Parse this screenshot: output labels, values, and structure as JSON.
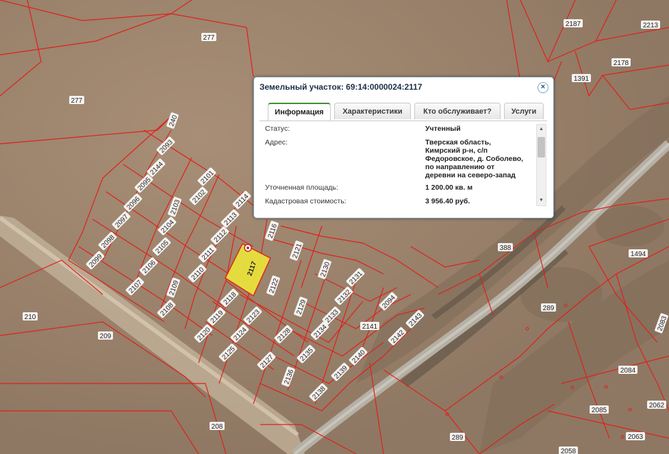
{
  "popup": {
    "title": "Земельный участок: 69:14:0000024:2117",
    "close_label": "×",
    "tabs": [
      "Информация",
      "Характеристики",
      "Кто обслуживает?",
      "Услуги"
    ],
    "active_tab": "Информация",
    "rows": [
      {
        "label": "Статус:",
        "value": "Учтенный"
      },
      {
        "label": "Адрес:",
        "value_lines": [
          "Тверская область,",
          "Кимрский р-н, с/п",
          "Федоровское, д. Соболево,",
          "по направлению от",
          "деревни на северо-запад"
        ]
      },
      {
        "label": "Уточненная площадь:",
        "value": "1 200.00 кв. м"
      },
      {
        "label": "Кадастровая стоимость:",
        "value": "3 956.40 руб."
      }
    ]
  },
  "map": {
    "selected_parcel": "2117",
    "parcel_labels": [
      "277",
      "277",
      "240",
      "2093",
      "2144",
      "2095",
      "2096",
      "2097",
      "2098",
      "2099",
      "2101",
      "2102",
      "2103",
      "2104",
      "2105",
      "2106",
      "2107",
      "2108",
      "2109",
      "2110",
      "2111",
      "2112",
      "2113",
      "2114",
      "2116",
      "2117",
      "2118",
      "2119",
      "2120",
      "2121",
      "2122",
      "2123",
      "2124",
      "2125",
      "2127",
      "2128",
      "2129",
      "2130",
      "2131",
      "2132",
      "2133",
      "2134",
      "2135",
      "2136",
      "2138",
      "2139",
      "2140",
      "2141",
      "2142",
      "2143",
      "2094",
      "2187",
      "2213",
      "2178",
      "1391",
      "388",
      "1494",
      "289",
      "2083",
      "2084",
      "2085",
      "2062",
      "2063",
      "2058",
      "289",
      "208",
      "209",
      "210"
    ]
  },
  "colors": {
    "parcel_line": "#e0201a",
    "selected_fill": "#e8e233",
    "ground": "#a08670",
    "road": "#b9b3a4"
  }
}
